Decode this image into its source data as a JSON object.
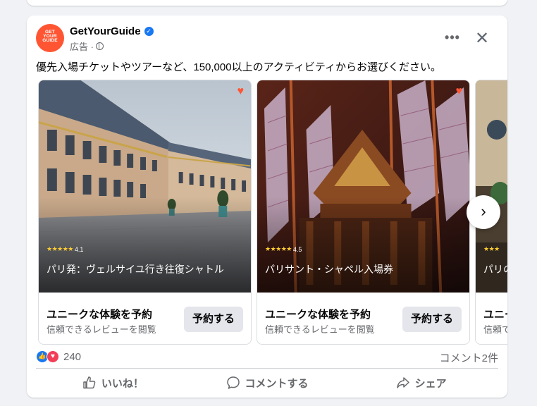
{
  "post": {
    "advertiser": "GetYourGuide",
    "avatar_text": [
      "GET",
      "YOUR",
      "GUIDE"
    ],
    "meta_label": "広告 ·",
    "body": "優先入場チケットやツアーなど、150,000以上のアクティビティからお選びください。"
  },
  "carousel": {
    "cards": [
      {
        "rating": "4.1",
        "caption": "パリ発：ヴェルサイユ行き往復シャトル",
        "cta_title": "ユニークな体験を予約",
        "cta_sub": "信頼できるレビューを閲覧",
        "button": "予約する"
      },
      {
        "rating": "4.5",
        "caption": "パリサント・シャペル入場券",
        "cta_title": "ユニークな体験を予約",
        "cta_sub": "信頼できるレビューを閲覧",
        "button": "予約する"
      },
      {
        "rating": "",
        "caption": "パリの",
        "cta_title": "ユニー",
        "cta_sub": "信頼で",
        "button": ""
      }
    ]
  },
  "stats": {
    "reaction_count": "240",
    "comment_count": "コメント2件"
  },
  "actions": {
    "like": "いいね！",
    "comment": "コメントする",
    "share": "シェア"
  },
  "colors": {
    "brand": "#ff5533",
    "facebook_blue": "#1877f2",
    "love_red": "#f33e58"
  },
  "icons": [
    "verified-badge-icon",
    "globe-icon",
    "more-options-icon",
    "close-icon",
    "heart-icon",
    "star-icon",
    "chevron-right-icon",
    "like-reaction-icon",
    "love-reaction-icon",
    "thumbs-up-icon",
    "comment-icon",
    "share-icon"
  ]
}
